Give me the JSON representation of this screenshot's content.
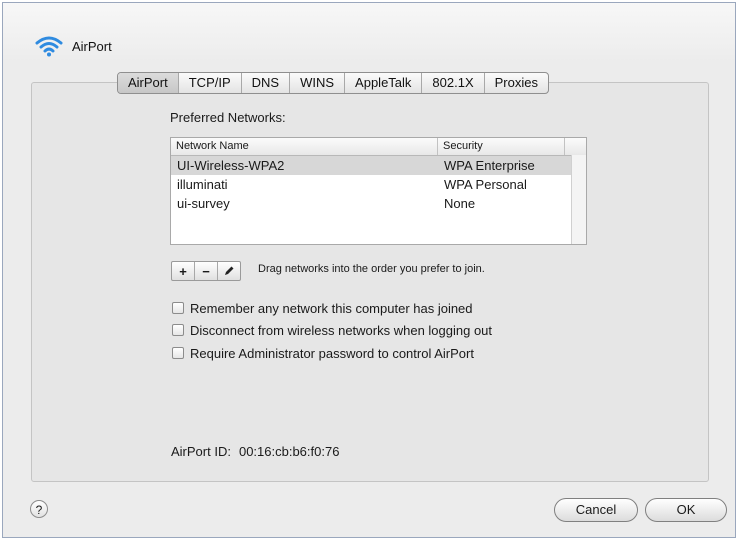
{
  "window": {
    "title": "AirPort",
    "icon": "wifi-icon"
  },
  "tabs": [
    {
      "label": "AirPort",
      "active": true
    },
    {
      "label": "TCP/IP",
      "active": false
    },
    {
      "label": "DNS",
      "active": false
    },
    {
      "label": "WINS",
      "active": false
    },
    {
      "label": "AppleTalk",
      "active": false
    },
    {
      "label": "802.1X",
      "active": false
    },
    {
      "label": "Proxies",
      "active": false
    }
  ],
  "preferred": {
    "label": "Preferred Networks:",
    "columns": {
      "name": "Network Name",
      "security": "Security"
    },
    "rows": [
      {
        "name": "UI-Wireless-WPA2",
        "security": "WPA Enterprise",
        "selected": true
      },
      {
        "name": "illuminati",
        "security": "WPA Personal",
        "selected": false
      },
      {
        "name": "ui-survey",
        "security": "None",
        "selected": false
      }
    ]
  },
  "list_controls": {
    "add": "+",
    "remove": "−",
    "edit_icon": "pencil-icon",
    "hint": "Drag networks into the order you prefer to join."
  },
  "options": [
    {
      "label": "Remember any network this computer has joined",
      "checked": false
    },
    {
      "label": "Disconnect from wireless networks when logging out",
      "checked": false
    },
    {
      "label": "Require Administrator password to control AirPort",
      "checked": false
    }
  ],
  "airport_id": {
    "label": "AirPort ID:",
    "value": "00:16:cb:b6:f0:76"
  },
  "footer": {
    "help": "?",
    "cancel": "Cancel",
    "ok": "OK"
  },
  "colors": {
    "frame_border": "#9aa7bd",
    "wifi_blue": "#2f8be0",
    "selected_row": "#d7d7d7"
  }
}
